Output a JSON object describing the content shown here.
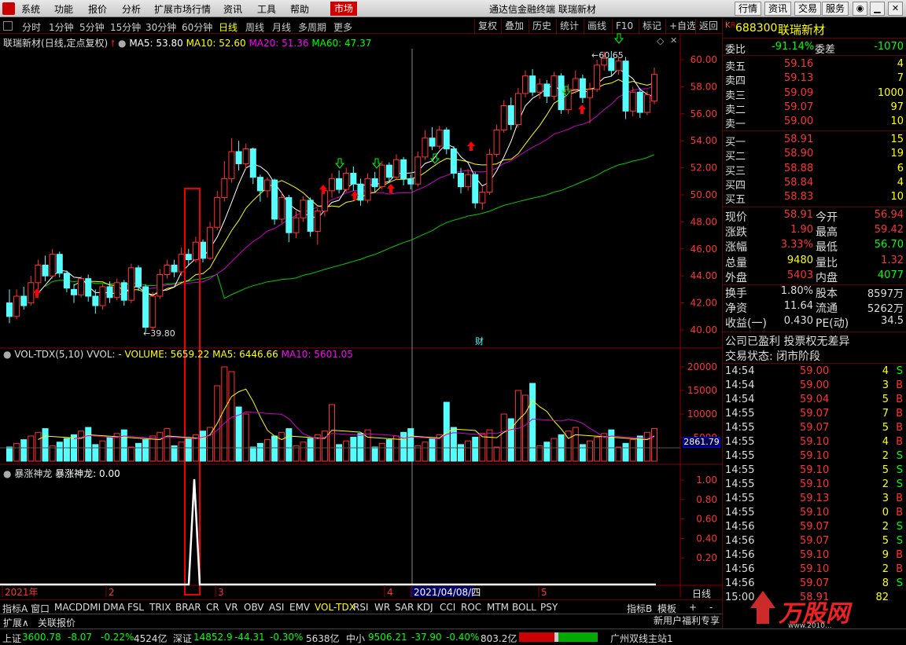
{
  "menu": {
    "items": [
      "系统",
      "功能",
      "报价",
      "分析",
      "扩展市场行情",
      "资讯",
      "工具",
      "帮助",
      "市场"
    ],
    "title": "通达信金融终端  联瑞新材",
    "right_buttons": [
      "行情",
      "资讯",
      "交易",
      "服务"
    ]
  },
  "periods": [
    "分时",
    "1分钟",
    "5分钟",
    "15分钟",
    "30分钟",
    "60分钟",
    "日线",
    "周线",
    "月线",
    "多周期",
    "更多"
  ],
  "right_tools": [
    "复权",
    "叠加",
    "历史",
    "统计",
    "画线",
    "F10",
    "标记",
    "+自选",
    "返回"
  ],
  "stock": {
    "name": "联瑞新材",
    "mode": "(日线,定点复权)",
    "ma5": "MA5: 53.80",
    "ma10": "MA10: 52.60",
    "ma20": "MA20: 51.36",
    "ma60": "MA60: 47.37",
    "high_label": "60.65",
    "low_label": "39.80",
    "cai": "财"
  },
  "vol": {
    "title": "VOL-TDX(5,10)",
    "vvol": "VVOL: -",
    "volume": "VOLUME: 5659.22",
    "ma5": "MA5: 6446.66",
    "ma10": "MA10: 5601.05",
    "current": "2861.79"
  },
  "ind": {
    "title": "暴涨神龙",
    "value": "暴涨神龙: 0.00"
  },
  "axis": {
    "price": [
      "60.00",
      "58.00",
      "56.00",
      "54.00",
      "52.00",
      "50.00",
      "48.00",
      "46.00",
      "44.00",
      "42.00",
      "40.00"
    ],
    "vol": [
      "20000",
      "15000",
      "10000",
      "5000"
    ],
    "ind": [
      "1.00",
      "0.80",
      "0.60",
      "0.40",
      "0.20"
    ],
    "dates": [
      "2021年",
      "2",
      "3",
      "4",
      "2021/04/08/四",
      "5"
    ],
    "period": "日线"
  },
  "tabs": [
    "指标A",
    "窗口",
    "MACD",
    "DMI",
    "DMA",
    "FSL",
    "TRIX",
    "BRAR",
    "CR",
    "VR",
    "OBV",
    "ASI",
    "EMV",
    "VOL-TDX",
    "RSI",
    "WR",
    "SAR",
    "KDJ",
    "CCI",
    "ROC",
    "MTM",
    "BOLL",
    "PSY"
  ],
  "tabs_right": [
    "指标B",
    "模板",
    "+",
    "-"
  ],
  "tabs2": [
    "扩展∧",
    "关联报价"
  ],
  "panel": {
    "code": "688300",
    "name": "联瑞新材",
    "weibi_label": "委比",
    "weibi": "-91.14%",
    "weicha_label": "委差",
    "weicha": "-1070",
    "asks": [
      {
        "l": "卖五",
        "p": "59.16",
        "v": "4"
      },
      {
        "l": "卖四",
        "p": "59.13",
        "v": "7"
      },
      {
        "l": "卖三",
        "p": "59.09",
        "v": "1000"
      },
      {
        "l": "卖二",
        "p": "59.07",
        "v": "97"
      },
      {
        "l": "卖一",
        "p": "59.00",
        "v": "10"
      }
    ],
    "bids": [
      {
        "l": "买一",
        "p": "58.91",
        "v": "15"
      },
      {
        "l": "买二",
        "p": "58.90",
        "v": "19"
      },
      {
        "l": "买三",
        "p": "58.88",
        "v": "6"
      },
      {
        "l": "买四",
        "p": "58.84",
        "v": "4"
      },
      {
        "l": "买五",
        "p": "58.83",
        "v": "10"
      }
    ],
    "stats": [
      [
        "现价",
        "58.91",
        "今开",
        "56.94"
      ],
      [
        "涨跌",
        "1.90",
        "最高",
        "59.42"
      ],
      [
        "涨幅",
        "3.33%",
        "最低",
        "56.70"
      ],
      [
        "总量",
        "9480",
        "量比",
        "1.32"
      ],
      [
        "外盘",
        "5403",
        "内盘",
        "4077"
      ],
      [
        "换手",
        "1.80%",
        "股本",
        "8597万"
      ],
      [
        "净资",
        "11.64",
        "流通",
        "5262万"
      ],
      [
        "收益(一)",
        "0.430",
        "PE(动)",
        "34.5"
      ]
    ],
    "note1": "公司已盈利 投票权无差异",
    "note2": "交易状态: 闭市阶段",
    "ticks": [
      [
        "14:54",
        "59.00",
        "4",
        "S"
      ],
      [
        "14:54",
        "59.00",
        "3",
        "B"
      ],
      [
        "14:54",
        "59.04",
        "5",
        "B"
      ],
      [
        "14:55",
        "59.07",
        "7",
        "B"
      ],
      [
        "14:55",
        "59.07",
        "5",
        "B"
      ],
      [
        "14:55",
        "59.10",
        "4",
        "B"
      ],
      [
        "14:55",
        "59.10",
        "2",
        "S"
      ],
      [
        "14:55",
        "59.10",
        "5",
        "S"
      ],
      [
        "14:55",
        "59.10",
        "2",
        "S"
      ],
      [
        "14:55",
        "59.13",
        "3",
        "B"
      ],
      [
        "14:55",
        "59.10",
        "0",
        "B"
      ],
      [
        "14:56",
        "59.07",
        "2",
        "S"
      ],
      [
        "14:56",
        "59.07",
        "5",
        "S"
      ],
      [
        "14:56",
        "59.10",
        "9",
        "B"
      ],
      [
        "14:56",
        "59.10",
        "2",
        "B"
      ],
      [
        "14:56",
        "59.07",
        "8",
        "S"
      ],
      [
        "15:00",
        "58.91",
        "82",
        ""
      ]
    ],
    "bottom": "新用户福利专享"
  },
  "status": {
    "sh": "上证",
    "sh_v": "3600.78",
    "sh_c": "-8.07",
    "sh_p": "-0.22%",
    "sh_a": "4524亿",
    "sz": "深证",
    "sz_v": "14852.9",
    "sz_c": "-44.31",
    "sz_p": "-0.30%",
    "sz_a": "5638亿",
    "zx": "中小",
    "zx_v": "9506.21",
    "zx_c": "-37.90",
    "zx_p": "-0.40%",
    "zx_a": "803.2亿",
    "station": "广州双线主站1"
  },
  "watermark": "万股网",
  "watermark_url": "www.2010..."
}
